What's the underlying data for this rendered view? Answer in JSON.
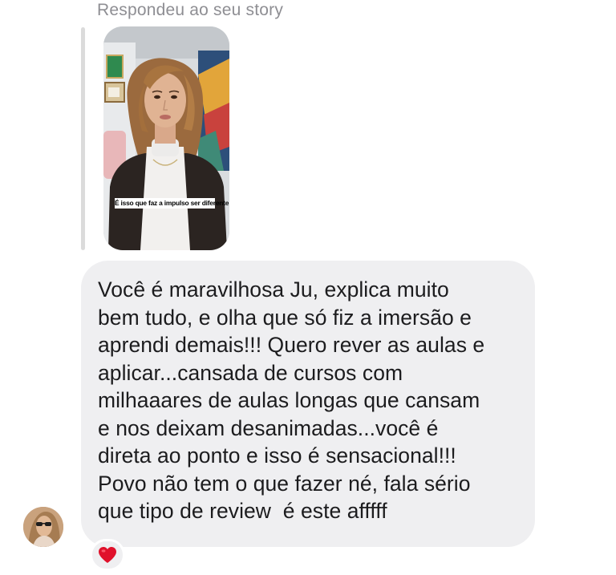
{
  "reply_context": {
    "label": "Respondeu ao seu story"
  },
  "story": {
    "caption": "É isso que faz a impulso ser diferente"
  },
  "message": {
    "lines": [
      "Você é maravilhosa Ju, explica muito",
      "bem tudo, e olha que só fiz a imersão e",
      "aprendi demais!!! Quero rever as aulas e",
      "aplicar...cansada de cursos com",
      "milhaaares de aulas longas que cansam",
      "e nos deixam desanimadas...você é",
      "direta ao ponto e isso é sensacional!!!",
      "Povo não tem o que fazer né, fala sério",
      "que tipo de review  é este afffff"
    ]
  },
  "reaction": {
    "icon": "red-heart-icon",
    "color": "#e0112b"
  },
  "colors": {
    "bubble_background": "#efeff1",
    "secondary_text": "#8e8e93"
  }
}
